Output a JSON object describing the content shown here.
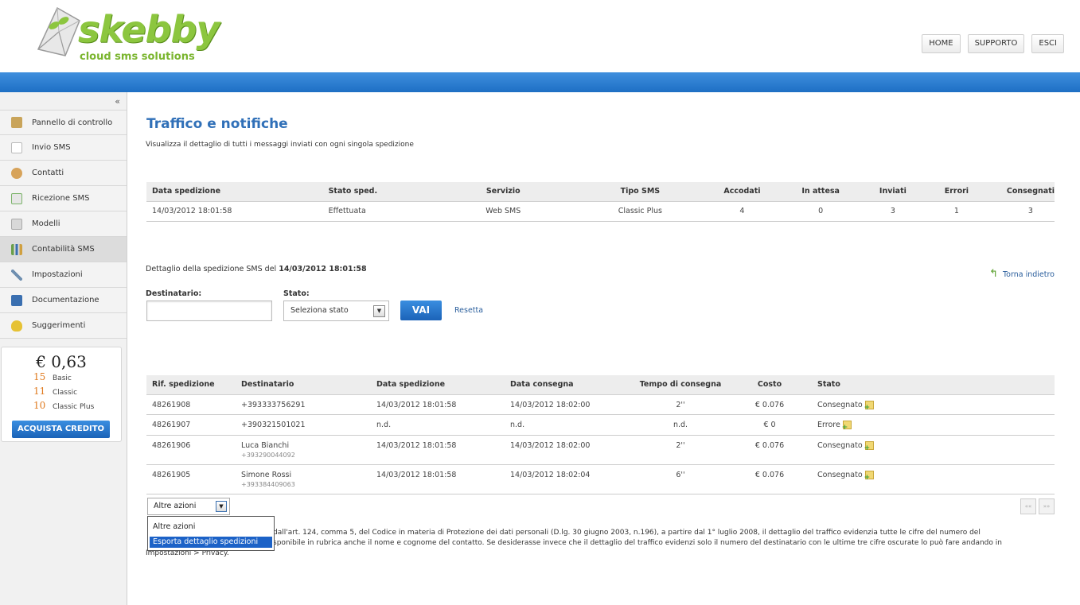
{
  "header": {
    "logo_text": "skebby",
    "logo_tagline": "cloud sms solutions",
    "nav": [
      "HOME",
      "SUPPORTO",
      "ESCI"
    ]
  },
  "sidebar": {
    "collapse": "«",
    "items": [
      {
        "label": "Pannello di controllo",
        "icon": "home-icon",
        "color": "#c9a45a"
      },
      {
        "label": "Invio SMS",
        "icon": "document-icon",
        "color": "#cfcfcf"
      },
      {
        "label": "Contatti",
        "icon": "contact-icon",
        "color": "#d7a35a"
      },
      {
        "label": "Ricezione SMS",
        "icon": "inbox-icon",
        "color": "#7bb36a"
      },
      {
        "label": "Modelli",
        "icon": "templates-icon",
        "color": "#b8b8b8"
      },
      {
        "label": "Contabilità SMS",
        "icon": "bar-chart-icon",
        "color": "#6a9f4a"
      },
      {
        "label": "Impostazioni",
        "icon": "tools-icon",
        "color": "#6f8fb0"
      },
      {
        "label": "Documentazione",
        "icon": "book-icon",
        "color": "#3a6fb0"
      },
      {
        "label": "Suggerimenti",
        "icon": "lightbulb-icon",
        "color": "#e6c234"
      }
    ],
    "credit": {
      "amount": "€ 0,63",
      "rows": [
        {
          "num": "15",
          "label": "Basic"
        },
        {
          "num": "11",
          "label": "Classic"
        },
        {
          "num": "10",
          "label": "Classic Plus"
        }
      ],
      "buy_label": "ACQUISTA CREDITO"
    }
  },
  "main": {
    "title": "Traffico e notifiche",
    "subtitle": "Visualizza il dettaglio di tutti i messaggi inviati con ogni singola spedizione",
    "summary": {
      "headers": [
        "Data spedizione",
        "Stato sped.",
        "Servizio",
        "Tipo SMS",
        "Accodati",
        "In attesa",
        "Inviati",
        "Errori",
        "Consegnati"
      ],
      "row": [
        "14/03/2012 18:01:58",
        "Effettuata",
        "Web SMS",
        "Classic Plus",
        "4",
        "0",
        "3",
        "1",
        "3"
      ]
    },
    "detail_prefix": "Dettaglio della spedizione SMS del ",
    "detail_date": "14/03/2012 18:01:58",
    "back_label": "Torna indietro",
    "filters": {
      "dest_label": "Destinatario:",
      "dest_value": "",
      "state_label": "Stato:",
      "state_value": "Seleziona stato",
      "go_label": "VAI",
      "reset_label": "Resetta"
    },
    "details": {
      "headers": [
        "Rif. spedizione",
        "Destinatario",
        "Data spedizione",
        "Data consegna",
        "Tempo di consegna",
        "Costo",
        "Stato"
      ],
      "rows": [
        {
          "ref": "48261908",
          "name": "+393333756291",
          "phone": "",
          "sent": "14/03/2012 18:01:58",
          "delivered": "14/03/2012 18:02:00",
          "time": "2''",
          "cost": "€ 0.076",
          "status": "Consegnato"
        },
        {
          "ref": "48261907",
          "name": "+390321501021",
          "phone": "",
          "sent": "n.d.",
          "delivered": "n.d.",
          "time": "n.d.",
          "cost": "€ 0",
          "status": "Errore"
        },
        {
          "ref": "48261906",
          "name": "Luca Bianchi",
          "phone": "+393290044092",
          "sent": "14/03/2012 18:01:58",
          "delivered": "14/03/2012 18:02:00",
          "time": "2''",
          "cost": "€ 0.076",
          "status": "Consegnato"
        },
        {
          "ref": "48261905",
          "name": "Simone Rossi",
          "phone": "+393384409063",
          "sent": "14/03/2012 18:01:58",
          "delivered": "14/03/2012 18:02:04",
          "time": "6''",
          "cost": "€ 0.076",
          "status": "Consegnato"
        }
      ]
    },
    "actions": {
      "value": "Altre azioni",
      "options": [
        "Altre azioni",
        "Esporta dettaglio spedizioni"
      ]
    },
    "pager": [
      "««",
      "»»"
    ],
    "privacy_line1": "dall'art. 124, comma 5, del Codice in materia di Protezione dei dati personali (D.lg. 30 giugno 2003, n.196), a partire dal 1° luglio 2008, il dettaglio del traffico evidenzia tutte le cifre del numero del",
    "privacy_line2": "sponibile in rubrica anche il nome e cognome del contatto. Se desiderasse invece che il dettaglio del traffico evidenzi solo il numero del destinatario con le ultime tre cifre oscurate lo può fare andando in",
    "privacy_line3": "Impostazioni > Privacy."
  }
}
